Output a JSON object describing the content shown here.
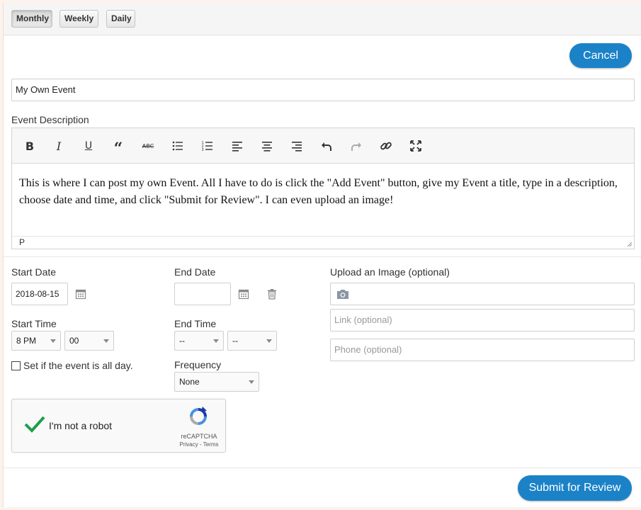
{
  "view_tabs": [
    "Monthly",
    "Weekly",
    "Daily"
  ],
  "active_view": "Monthly",
  "cancel_label": "Cancel",
  "event_title": "My Own Event",
  "description_label": "Event Description",
  "toolbar_icons": [
    "bold-icon",
    "italic-icon",
    "underline-icon",
    "blockquote-icon",
    "strikethrough-icon",
    "bullet-list-icon",
    "numbered-list-icon",
    "align-left-icon",
    "align-center-icon",
    "align-right-icon",
    "undo-icon",
    "redo-icon",
    "link-icon",
    "fullscreen-icon"
  ],
  "description_text": "This is where I can post my own Event. All I have to do is click the \"Add Event\" button, give my Event a title, type in a description, choose date and time, and click \"Submit for Review\". I can even upload an image!",
  "editor_status": "P",
  "start_date_label": "Start Date",
  "start_date_value": "2018-08-15",
  "end_date_label": "End Date",
  "end_date_value": "",
  "upload_label": "Upload an Image (optional)",
  "link_placeholder": "Link (optional)",
  "phone_placeholder": "Phone (optional)",
  "start_time_label": "Start Time",
  "start_hour": "8 PM",
  "start_minute": "00",
  "end_time_label": "End Time",
  "end_hour": "--",
  "end_minute": "--",
  "all_day_label": "Set if the event is all day.",
  "all_day_checked": false,
  "frequency_label": "Frequency",
  "frequency_value": "None",
  "captcha": {
    "label": "I'm not a robot",
    "brand": "reCAPTCHA",
    "links": "Privacy - Terms",
    "verified": true
  },
  "submit_label": "Submit for Review",
  "colors": {
    "primary": "#1b82c8",
    "check_green": "#1e9e4a"
  }
}
